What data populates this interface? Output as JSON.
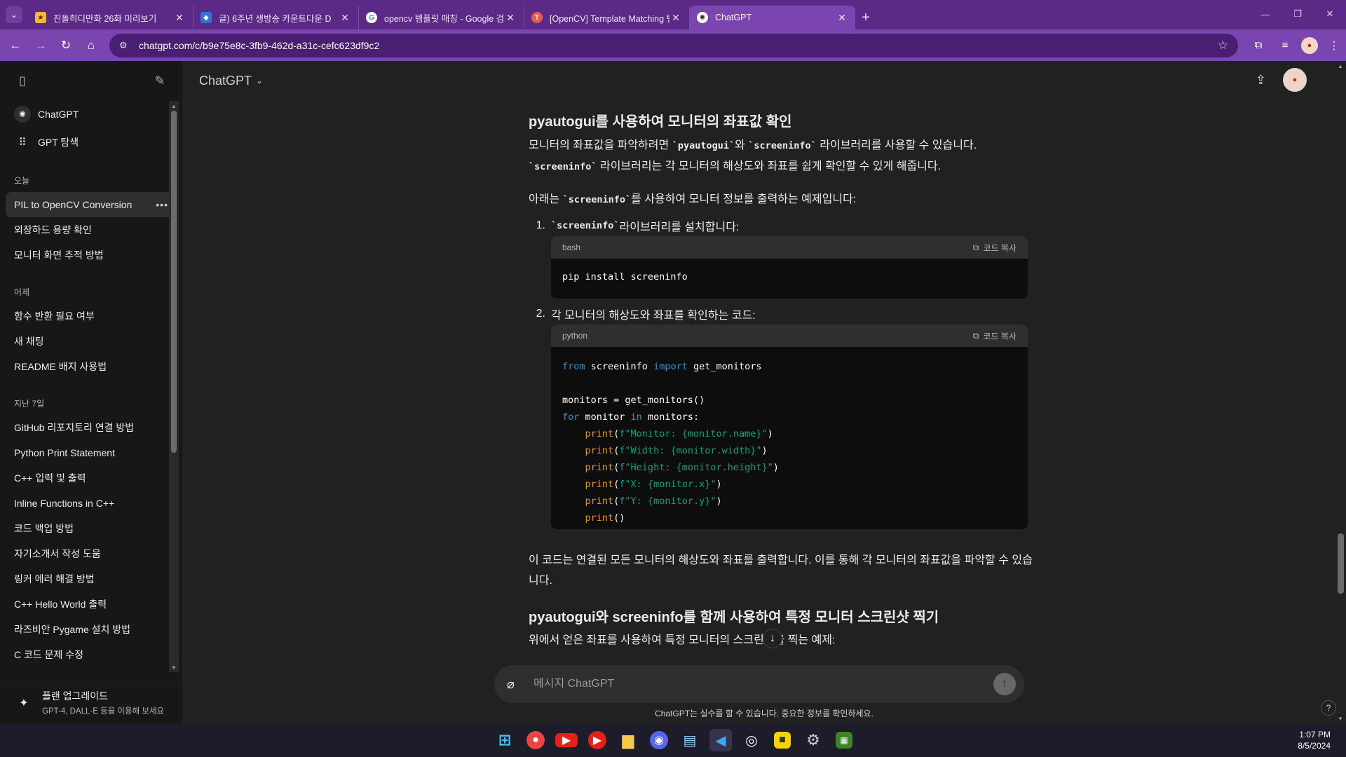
{
  "browser": {
    "tabs": [
      {
        "title": "진돌히디만화 26화 미리보기",
        "favicon_color": "#f2b640",
        "active": false
      },
      {
        "title": "글) 6주년 생방송 카운트다운 D",
        "favicon_color": "#3b6fd8",
        "active": false
      },
      {
        "title": "opencv 템플릿 매칭 - Google 검",
        "favicon_color": "#ffffff",
        "active": false
      },
      {
        "title": "[OpenCV] Template Matching 템",
        "favicon_color": "#e85d4a",
        "active": false
      },
      {
        "title": "ChatGPT",
        "favicon_color": "#ffffff",
        "active": true
      }
    ],
    "new_tab_label": "+",
    "url": "chatgpt.com/c/b9e75e8c-3fb9-462d-a31c-cefc623df9c2"
  },
  "sidebar": {
    "top_items": [
      {
        "label": "ChatGPT"
      },
      {
        "label": "GPT 탐색"
      }
    ],
    "sections": [
      {
        "title": "오늘",
        "items": [
          "PIL to OpenCV Conversion",
          "외장하드 용량 확인",
          "모니터 화면 추적 방법"
        ]
      },
      {
        "title": "어제",
        "items": [
          "함수 반환 필요 여부",
          "새 채팅",
          "README 배지 사용법"
        ]
      },
      {
        "title": "지난 7일",
        "items": [
          "GitHub 리포지토리 연결 방법",
          "Python Print Statement",
          "C++ 입력 및 출력",
          "Inline Functions in C++",
          "코드 백업 방법",
          "자기소개서 작성 도움",
          "링커 에러 해결 방법",
          "C++ Hello World 출력",
          "라즈비안 Pygame 설치 방법",
          "C 코드 문제 수정"
        ]
      }
    ],
    "upgrade": {
      "title": "플랜 업그레이드",
      "subtitle": "GPT-4, DALL·E 등을 이용해 보세요"
    }
  },
  "header": {
    "model": "ChatGPT"
  },
  "message": {
    "heading1": "pyautogui를 사용하여 모니터의 좌표값 확인",
    "para1_a": "모니터의 좌표값을 파악하려면 ",
    "para1_code1": "`pyautogui`",
    "para1_b": "와 ",
    "para1_code2": "`screeninfo`",
    "para1_c": " 라이브러리를 사용할 수 있습니다.",
    "para1_code3": "`screeninfo`",
    "para1_d": " 라이브러리는 각 모니터의 해상도와 좌표를 쉽게 확인할 수 있게 해줍니다.",
    "para2_a": "아래는 ",
    "para2_code": "`screeninfo`",
    "para2_b": "를 사용하여 모니터 정보를 출력하는 예제입니다:",
    "step1_num": "1.",
    "step1_code": "`screeninfo`",
    "step1_text": " 라이브러리를 설치합니다:",
    "code1": {
      "lang": "bash",
      "copy_label": "코드 복사",
      "line": "pip install screeninfo"
    },
    "step2_num": "2.",
    "step2_text": "각 모니터의 해상도와 좌표를 확인하는 코드:",
    "code2": {
      "lang": "python",
      "copy_label": "코드 복사",
      "l1_kw1": "from",
      "l1_mod": " screeninfo ",
      "l1_kw2": "import",
      "l1_name": " get_monitors",
      "l3": "monitors = get_monitors()",
      "l4_kw1": "for",
      "l4_mid": " monitor ",
      "l4_kw2": "in",
      "l4_end": " monitors:",
      "print_fn": "print",
      "l5_str": "f\"Monitor: {monitor.name}\"",
      "l6_str": "f\"Width: {monitor.width}\"",
      "l7_str": "f\"Height: {monitor.height}\"",
      "l8_str": "f\"X: {monitor.x}\"",
      "l9_str": "f\"Y: {monitor.y}\"",
      "l10": "()"
    },
    "para3": "이 코드는 연결된 모든 모니터의 해상도와 좌표를 출력합니다. 이를 통해 각 모니터의 좌표값을 파악할 수 있습니다.",
    "heading2": "pyautogui와 screeninfo를 함께 사용하여 특정 모니터 스크린샷 찍기",
    "para4": "위에서 얻은 좌표를 사용하여 특정 모니터의 스크린샷을 찍는 예제:"
  },
  "composer": {
    "placeholder": "메시지 ChatGPT"
  },
  "disclaimer": "ChatGPT는 실수를 할 수 있습니다. 중요한 정보를 확인하세요.",
  "help_label": "?",
  "taskbar": {
    "time": "1:07 PM",
    "date": "8/5/2024"
  }
}
